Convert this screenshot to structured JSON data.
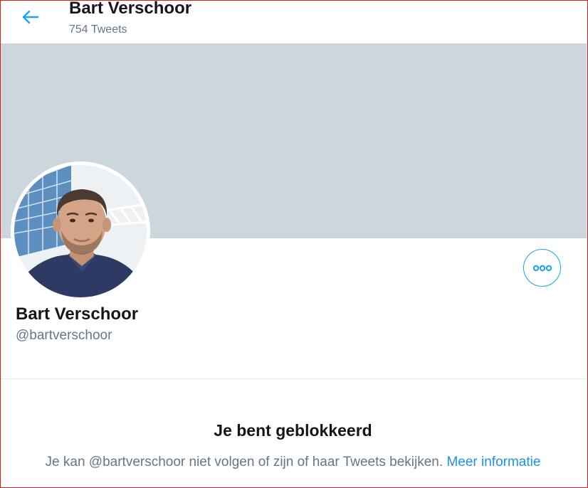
{
  "header": {
    "name": "Bart Verschoor",
    "tweet_count": "754 Tweets",
    "back_icon": "arrow-left-icon"
  },
  "profile": {
    "name": "Bart Verschoor",
    "handle": "@bartverschoor",
    "more_icon": "more-horizontal-icon"
  },
  "blocked": {
    "title": "Je bent geblokkeerd",
    "message": "Je kan @bartverschoor niet volgen of zijn of haar Tweets bekijken.",
    "link": "Meer informatie"
  },
  "colors": {
    "accent": "#1da1f2",
    "link": "#1b95e0",
    "banner": "#ccd6dd",
    "secondary_text": "#657786"
  }
}
